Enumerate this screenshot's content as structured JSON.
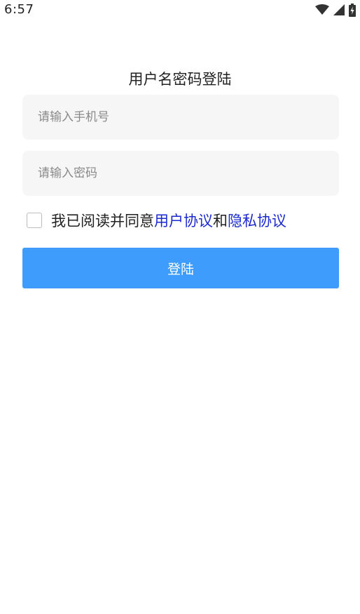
{
  "status_bar": {
    "time": "6:57",
    "icons": [
      "wifi-icon",
      "cell-signal-icon",
      "battery-charging-icon"
    ]
  },
  "page": {
    "title": "用户名密码登陆"
  },
  "form": {
    "phone_placeholder": "请输入手机号",
    "phone_value": "",
    "password_placeholder": "请输入密码",
    "password_value": ""
  },
  "agreement": {
    "checked": false,
    "prefix": "我已阅读并同意",
    "user_agreement_link": "用户协议",
    "conjunction": "和",
    "privacy_policy_link": "隐私协议"
  },
  "login_button": {
    "label": "登陆"
  },
  "colors": {
    "accent": "#3d9cfc",
    "link": "#1a2ad0",
    "input_background": "#f6f6f6"
  }
}
